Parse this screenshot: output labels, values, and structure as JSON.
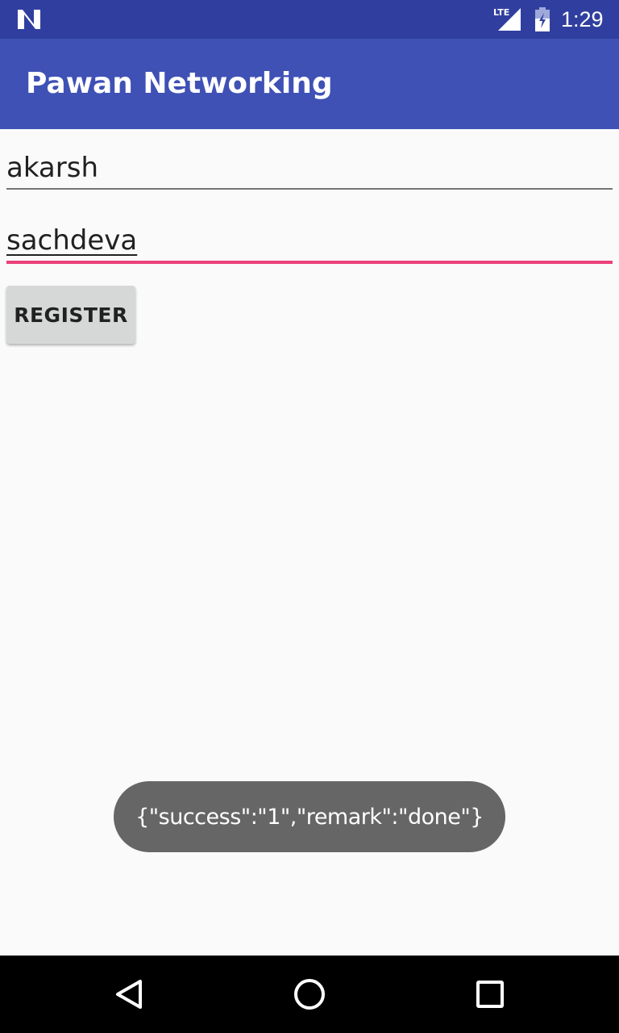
{
  "status_bar": {
    "time": "1:29",
    "network_label": "LTE",
    "icons": [
      "notification-n-icon",
      "lte-signal-icon",
      "battery-icon"
    ]
  },
  "app_bar": {
    "title": "Pawan Networking",
    "color": "#3f51b5"
  },
  "form": {
    "first_field_value": "akarsh",
    "second_field_value": "sachdeva",
    "register_label": "REGISTER",
    "accent_color": "#ec407a"
  },
  "toast": {
    "message": "{\"success\":\"1\",\"remark\":\"done\"}"
  },
  "nav_bar": {
    "icons": [
      "back-icon",
      "home-icon",
      "recents-icon"
    ]
  }
}
